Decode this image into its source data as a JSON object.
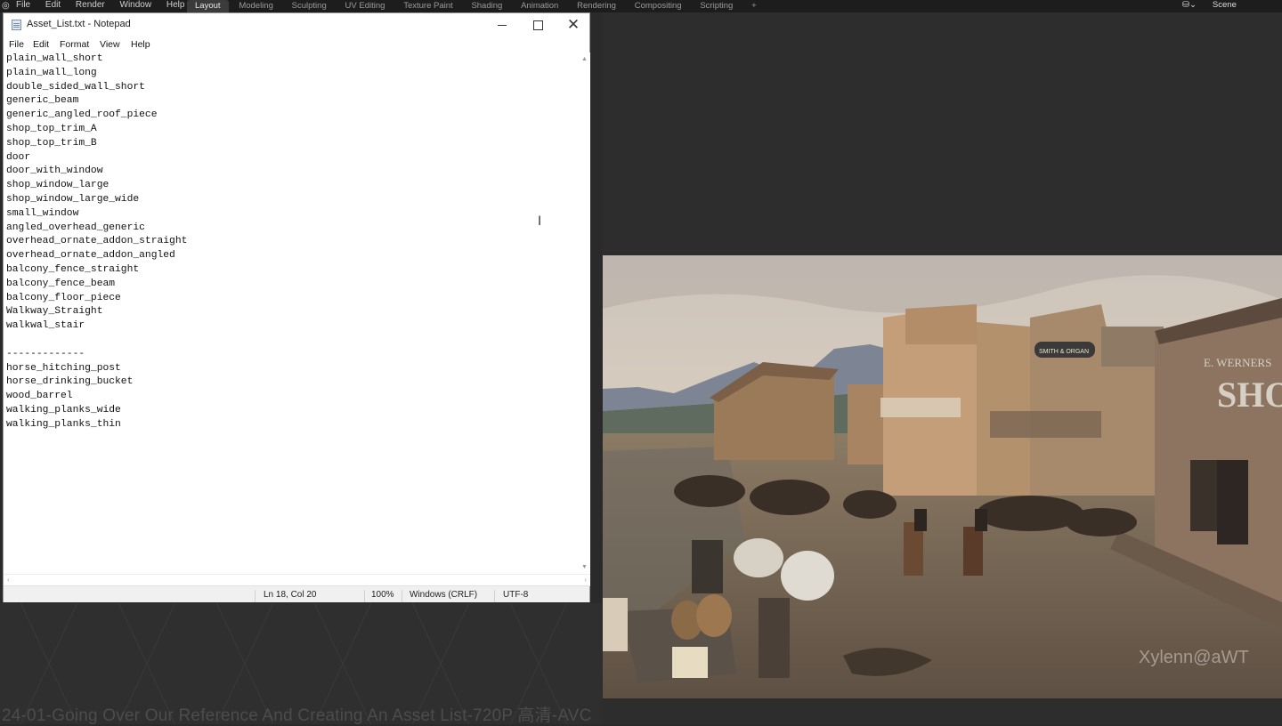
{
  "blender": {
    "logo": "◎",
    "menu": [
      "File",
      "Edit",
      "Render",
      "Window",
      "Help"
    ],
    "tabs": [
      {
        "label": "Layout",
        "active": true
      },
      {
        "label": "Modeling",
        "active": false
      },
      {
        "label": "Sculpting",
        "active": false
      },
      {
        "label": "UV Editing",
        "active": false
      },
      {
        "label": "Texture Paint",
        "active": false
      },
      {
        "label": "Shading",
        "active": false
      },
      {
        "label": "Animation",
        "active": false
      },
      {
        "label": "Rendering",
        "active": false
      },
      {
        "label": "Compositing",
        "active": false
      },
      {
        "label": "Scripting",
        "active": false
      }
    ],
    "add_tab": "+",
    "scene_icon": "⛁⌄",
    "scene_label": "Scene"
  },
  "notepad": {
    "title": "Asset_List.txt - Notepad",
    "window_controls": {
      "minimize": "",
      "maximize": "",
      "close": "✕"
    },
    "menu": [
      "File",
      "Edit",
      "Format",
      "View",
      "Help"
    ],
    "lines": [
      "plain_wall_short",
      "plain_wall_long",
      "double_sided_wall_short",
      "generic_beam",
      "generic_angled_roof_piece",
      "shop_top_trim_A",
      "shop_top_trim_B",
      "door",
      "door_with_window",
      "shop_window_large",
      "shop_window_large_wide",
      "small_window",
      "angled_overhead_generic",
      "overhead_ornate_addon_straight",
      "overhead_ornate_addon_angled",
      "balcony_fence_straight",
      "balcony_fence_beam",
      "balcony_floor_piece",
      "Walkway_Straight",
      "walkwal_stair",
      "",
      "-------------",
      "horse_hitching_post",
      "horse_drinking_bucket",
      "wood_barrel",
      "walking_planks_wide",
      "walking_planks_thin"
    ],
    "status": {
      "position": "Ln 18, Col 20",
      "zoom": "100%",
      "line_ending": "Windows (CRLF)",
      "encoding": "UTF-8"
    }
  },
  "reference_image": {
    "shop_sign": "SHOP",
    "sign_small": "E. WERNERS",
    "hanging_sign": "SMITH & ORGAN",
    "watermark": "Xylenn@aWT"
  },
  "caption": "24-01-Going Over Our Reference And Creating An Asset List-720P 高清-AVC"
}
